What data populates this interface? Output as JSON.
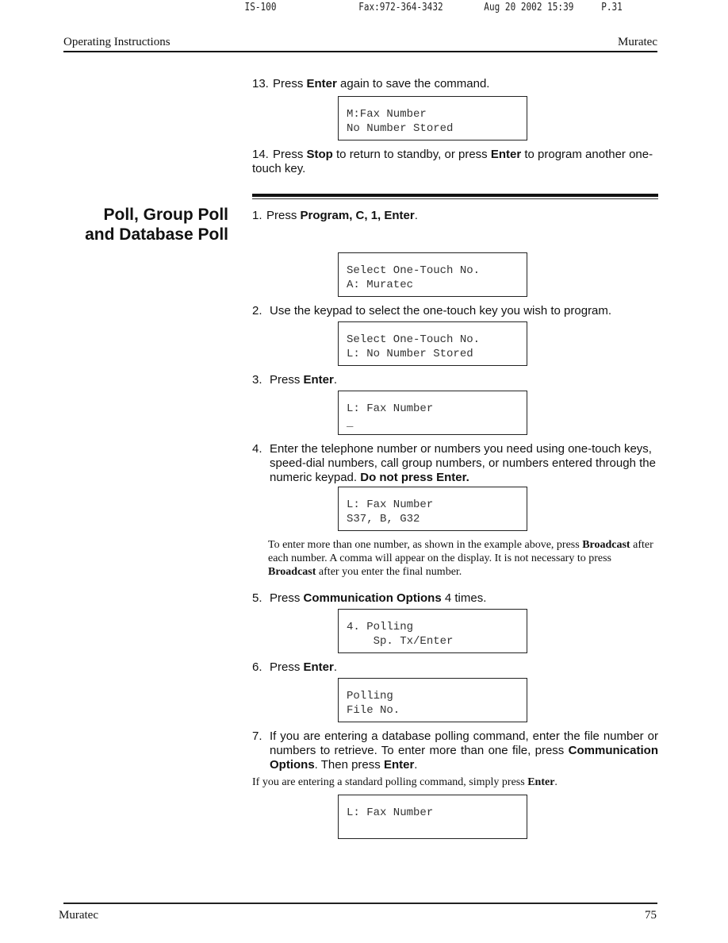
{
  "fax_header": {
    "machine": "IS-100",
    "fax": "Fax:972-364-3432",
    "datetime": "Aug 20 2002 15:39",
    "page": "P.31"
  },
  "running_head": {
    "left": "Operating Instructions",
    "right": "Muratec"
  },
  "prev_steps": [
    {
      "num": "13.",
      "parts": [
        {
          "t": "Press "
        },
        {
          "t": "Enter",
          "b": true
        },
        {
          "t": " again to save the command."
        }
      ]
    },
    {
      "num": "14.",
      "parts": [
        {
          "t": "Press "
        },
        {
          "t": "Stop",
          "b": true
        },
        {
          "t": " to return to standby, or press "
        },
        {
          "t": "Enter",
          "b": true
        },
        {
          "t": " to program another one-touch key."
        }
      ]
    }
  ],
  "lcd_13": [
    "M:Fax Number",
    "No Number Stored"
  ],
  "section": {
    "title_line1": "Poll, Group Poll",
    "title_line2": "and Database Poll"
  },
  "steps": {
    "s1": {
      "num": "1.",
      "parts": [
        {
          "t": "Press "
        },
        {
          "t": "Program, C, 1, Enter",
          "b": true
        },
        {
          "t": "."
        }
      ]
    },
    "s2": {
      "num": "2.",
      "parts": [
        {
          "t": "Use the keypad to select the one-touch key you wish to program."
        }
      ]
    },
    "s3": {
      "num": "3.",
      "parts": [
        {
          "t": "Press "
        },
        {
          "t": "Enter",
          "b": true
        },
        {
          "t": "."
        }
      ]
    },
    "s4": {
      "num": "4.",
      "parts": [
        {
          "t": "Enter the telephone number or numbers you need using one-touch keys, speed-dial numbers, call group numbers, or numbers entered through the numeric keypad. "
        },
        {
          "t": "Do not press Enter.",
          "b": true
        }
      ]
    },
    "s5": {
      "num": "5.",
      "parts": [
        {
          "t": "Press "
        },
        {
          "t": "Communication Options",
          "b": true
        },
        {
          "t": " 4 times."
        }
      ]
    },
    "s6": {
      "num": "6.",
      "parts": [
        {
          "t": "Press "
        },
        {
          "t": "Enter",
          "b": true
        },
        {
          "t": "."
        }
      ]
    },
    "s7": {
      "num": "7.",
      "parts": [
        {
          "t": "If you are entering a database polling command, enter the file number or numbers to retrieve. To enter more than one file, press "
        },
        {
          "t": "Communication Options",
          "b": true
        },
        {
          "t": ". Then press "
        },
        {
          "t": "Enter",
          "b": true
        },
        {
          "t": "."
        }
      ]
    }
  },
  "lcds": {
    "l1": [
      "Select One-Touch No.",
      "A: Muratec"
    ],
    "l2": [
      "Select One-Touch No.",
      "L: No Number Stored"
    ],
    "l3": [
      "L: Fax Number",
      "_"
    ],
    "l4": [
      "L: Fax Number",
      "S37, B, G32"
    ],
    "l5": [
      "4. Polling",
      "    Sp. Tx/Enter"
    ],
    "l6": [
      "Polling",
      "File No."
    ],
    "l7": [
      "L: Fax Number",
      ""
    ]
  },
  "notes": {
    "broadcast": [
      {
        "t": "To enter more than one number, as shown in the example above, press "
      },
      {
        "t": "Broadcast",
        "b": true
      },
      {
        "t": " after each number. A comma will appear on the display. It is not necessary to press "
      },
      {
        "t": "Broadcast",
        "b": true
      },
      {
        "t": " after you enter the final number."
      }
    ],
    "standard": [
      {
        "t": "If you are entering a standard polling command, simply press "
      },
      {
        "t": "Enter",
        "b": true
      },
      {
        "t": "."
      }
    ]
  },
  "footer": {
    "left": "Muratec",
    "page_number": "75"
  }
}
